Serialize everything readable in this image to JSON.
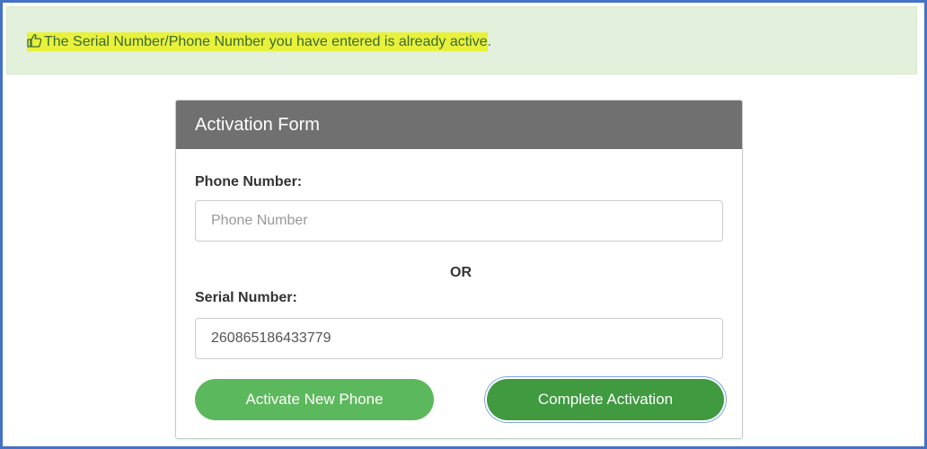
{
  "alert": {
    "icon": "thumbs-up-icon",
    "message_highlighted": "The Serial Number",
    "message_rest": "/Phone Number you have entered is already ",
    "message_highlighted_end": "active",
    "message_period": "."
  },
  "form": {
    "title": "Activation Form",
    "phone_label": "Phone Number:",
    "phone_value": "",
    "phone_placeholder": "Phone Number",
    "or_text": "OR",
    "serial_label": "Serial Number:",
    "serial_value": "260865186433779",
    "activate_new_label": "Activate New Phone",
    "complete_label": "Complete Activation"
  },
  "colors": {
    "frame_border": "#4472c4",
    "alert_bg": "#e3f0db",
    "highlight": "#e8f13b",
    "panel_heading": "#707070",
    "btn_light": "#5cb85c",
    "btn_dark": "#3f9a40"
  }
}
